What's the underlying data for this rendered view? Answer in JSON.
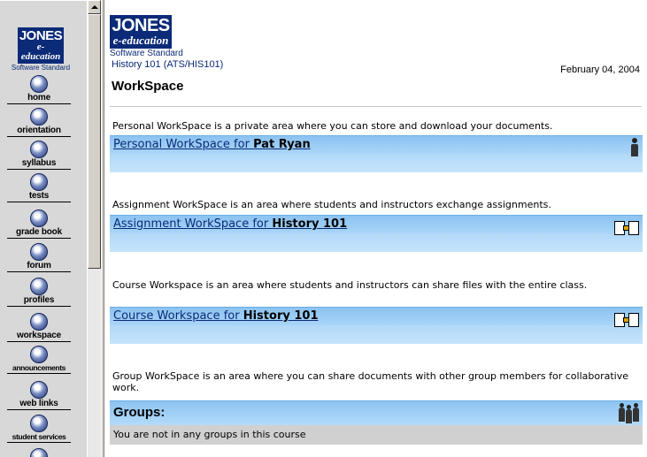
{
  "brand": {
    "name": "JONES",
    "sub": "e-education",
    "tagline": "Software Standard"
  },
  "nav": [
    {
      "label": "home",
      "icon": "home-icon"
    },
    {
      "label": "orientation",
      "icon": "orientation-icon"
    },
    {
      "label": "syllabus",
      "icon": "syllabus-icon"
    },
    {
      "label": "tests",
      "icon": "tests-icon"
    },
    {
      "label": "grade book",
      "icon": "grade-book-icon"
    },
    {
      "label": "forum",
      "icon": "forum-icon"
    },
    {
      "label": "profiles",
      "icon": "profiles-icon"
    },
    {
      "label": "workspace",
      "icon": "workspace-icon"
    },
    {
      "label": "announcements",
      "icon": "announcements-icon"
    },
    {
      "label": "web links",
      "icon": "web-links-icon"
    },
    {
      "label": "student services",
      "icon": "student-services-icon"
    }
  ],
  "header": {
    "course": "History 101 (ATS/HIS101)",
    "date": "February 04, 2004",
    "title": "WorkSpace"
  },
  "personal": {
    "desc": "Personal WorkSpace is a private area where you can store and download your documents.",
    "link_prefix": "Personal WorkSpace for ",
    "link_name": "Pat Ryan"
  },
  "assignment": {
    "desc": "Assignment WorkSpace is an area where students and instructors exchange assignments.",
    "link_prefix": "Assignment WorkSpace for ",
    "link_name": "History 101"
  },
  "course": {
    "desc": "Course Workspace is an area where students and instructors can share files with the entire class.",
    "link_prefix": "Course Workspace for ",
    "link_name": "History 101"
  },
  "group": {
    "desc": "Group WorkSpace is an area where you can share documents with other group members for collaborative work.",
    "heading": "Groups:",
    "message": "You are not in any groups in this course"
  }
}
